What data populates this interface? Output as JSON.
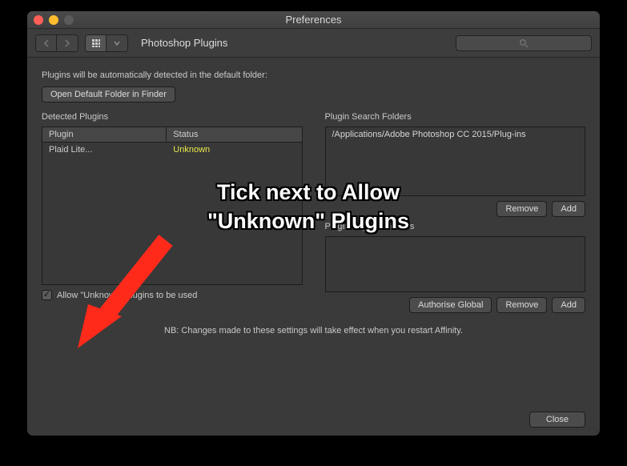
{
  "window": {
    "title": "Preferences",
    "breadcrumb": "Photoshop Plugins"
  },
  "toolbar": {
    "search_placeholder": ""
  },
  "content": {
    "auto_detect_line": "Plugins will be automatically detected in the default folder:",
    "open_default_btn": "Open Default Folder in Finder",
    "detected_label": "Detected Plugins",
    "search_folders_label": "Plugin Search Folders",
    "plugin_support_label": "Plugin Support Folders",
    "table_headers": {
      "plugin": "Plugin",
      "status": "Status"
    },
    "detected_rows": [
      {
        "plugin": "Plaid Lite...",
        "status": "Unknown"
      }
    ],
    "search_folder_rows": [
      "/Applications/Adobe Photoshop CC 2015/Plug-ins"
    ],
    "buttons": {
      "remove": "Remove",
      "add": "Add",
      "authorise_global": "Authorise Global",
      "close": "Close"
    },
    "allow_unknown_label": "Allow \"Unknown\" plugins to be used",
    "allow_unknown_checked": "✓",
    "footnote": "NB: Changes made to these settings will take effect when you restart Affinity."
  },
  "annotation": {
    "line1": "Tick next to Allow",
    "line2": "\"Unknown\" Plugins"
  },
  "colors": {
    "status_unknown": "#e8e84a",
    "arrow": "#ff2a1a"
  }
}
